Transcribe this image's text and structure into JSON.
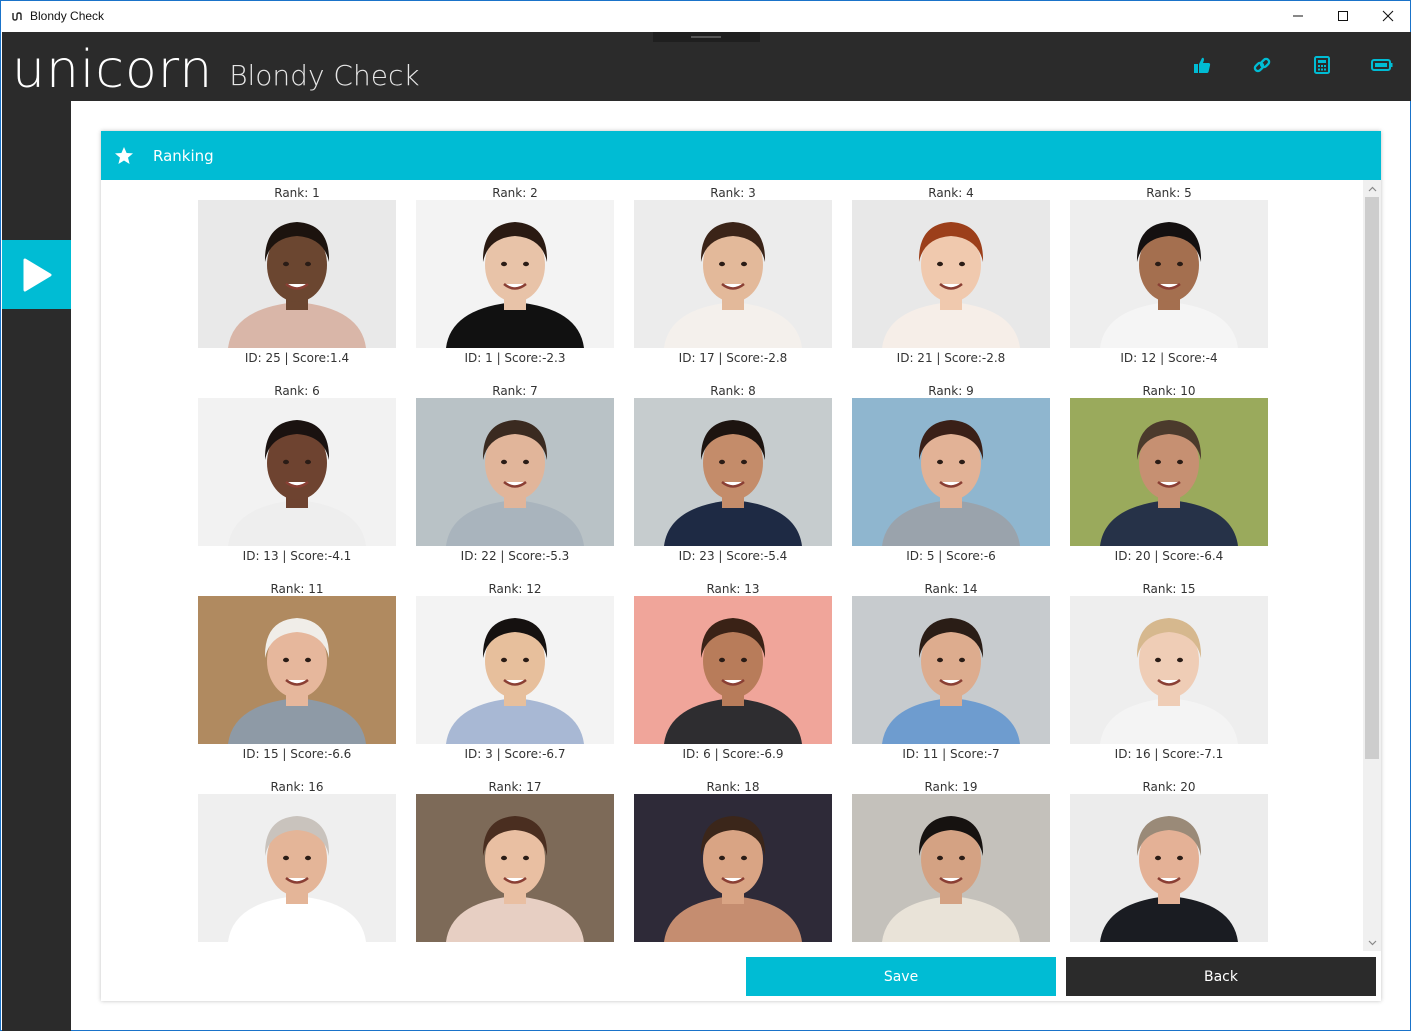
{
  "window": {
    "title": "Blondy Check",
    "controls": [
      "minimize",
      "maximize",
      "close"
    ]
  },
  "header": {
    "brand": "unicorn",
    "app_name": "Blondy Check",
    "icons": [
      "thumbs-up-icon",
      "link-icon",
      "calculator-icon",
      "battery-icon"
    ],
    "accent_color": "#00bcd4"
  },
  "rail": {
    "play_icon": "play-icon"
  },
  "panel": {
    "title": "Ranking",
    "title_icon": "star-icon"
  },
  "ranking": [
    {
      "rank_label": "Rank: 1",
      "caption": "ID: 25 | Score:1.4",
      "bg": "#e9e9e9",
      "skin": "#6b4630",
      "hair": "#1c130e",
      "shirt": "#d9b6a8"
    },
    {
      "rank_label": "Rank: 2",
      "caption": "ID: 1 | Score:-2.3",
      "bg": "#f3f3f3",
      "skin": "#e8c3a8",
      "hair": "#2a1a12",
      "shirt": "#111111"
    },
    {
      "rank_label": "Rank: 3",
      "caption": "ID: 17 | Score:-2.8",
      "bg": "#ececec",
      "skin": "#e3b99a",
      "hair": "#3b2418",
      "shirt": "#f4f0ec"
    },
    {
      "rank_label": "Rank: 4",
      "caption": "ID: 21 | Score:-2.8",
      "bg": "#e8e8e8",
      "skin": "#f0c9ae",
      "hair": "#9c3f1a",
      "shirt": "#f6eee8"
    },
    {
      "rank_label": "Rank: 5",
      "caption": "ID: 12 | Score:-4",
      "bg": "#eeeeee",
      "skin": "#a46f4f",
      "hair": "#141010",
      "shirt": "#f5f5f5"
    },
    {
      "rank_label": "Rank: 6",
      "caption": "ID: 13 | Score:-4.1",
      "bg": "#f2f2f2",
      "skin": "#6e4330",
      "hair": "#1a1210",
      "shirt": "#eeeeee"
    },
    {
      "rank_label": "Rank: 7",
      "caption": "ID: 22 | Score:-5.3",
      "bg": "#b9c2c6",
      "skin": "#e1b59a",
      "hair": "#3a2a20",
      "shirt": "#a9b4bd"
    },
    {
      "rank_label": "Rank: 8",
      "caption": "ID: 23 | Score:-5.4",
      "bg": "#c6ccce",
      "skin": "#c48c6a",
      "hair": "#1d1410",
      "shirt": "#1e2a44"
    },
    {
      "rank_label": "Rank: 9",
      "caption": "ID: 5 | Score:-6",
      "bg": "#8fb6cf",
      "skin": "#e2b296",
      "hair": "#3a2018",
      "shirt": "#9aa3ac"
    },
    {
      "rank_label": "Rank: 10",
      "caption": "ID: 20 | Score:-6.4",
      "bg": "#9aaa5c",
      "skin": "#c69072",
      "hair": "#4b3a2c",
      "shirt": "#263248"
    },
    {
      "rank_label": "Rank: 11",
      "caption": "ID: 15 | Score:-6.6",
      "bg": "#b08a60",
      "skin": "#e6b79c",
      "hair": "#f0ede8",
      "shirt": "#8e9aa6"
    },
    {
      "rank_label": "Rank: 12",
      "caption": "ID: 3 | Score:-6.7",
      "bg": "#f3f3f3",
      "skin": "#e7bf9c",
      "hair": "#151110",
      "shirt": "#a8b8d4"
    },
    {
      "rank_label": "Rank: 13",
      "caption": "ID: 6 | Score:-6.9",
      "bg": "#f0a59a",
      "skin": "#b87c5a",
      "hair": "#3a2216",
      "shirt": "#2e2d30"
    },
    {
      "rank_label": "Rank: 14",
      "caption": "ID: 11 | Score:-7",
      "bg": "#c7cbce",
      "skin": "#ddac8e",
      "hair": "#2a1d16",
      "shirt": "#6e9ccf"
    },
    {
      "rank_label": "Rank: 15",
      "caption": "ID: 16 | Score:-7.1",
      "bg": "#eeeeee",
      "skin": "#efcdb6",
      "hair": "#d6b88e",
      "shirt": "#f4f4f4"
    },
    {
      "rank_label": "Rank: 16",
      "caption": "",
      "bg": "#efefef",
      "skin": "#e4b598",
      "hair": "#c9c3bd",
      "shirt": "#ffffff"
    },
    {
      "rank_label": "Rank: 17",
      "caption": "",
      "bg": "#7d6a58",
      "skin": "#e9bfa2",
      "hair": "#4a2e20",
      "shirt": "#e7cfc3"
    },
    {
      "rank_label": "Rank: 18",
      "caption": "",
      "bg": "#2e2a38",
      "skin": "#d9a484",
      "hair": "#3b261a",
      "shirt": "#c58d70"
    },
    {
      "rank_label": "Rank: 19",
      "caption": "",
      "bg": "#c4c1bb",
      "skin": "#d4a283",
      "hair": "#161210",
      "shirt": "#e9e3d8"
    },
    {
      "rank_label": "Rank: 20",
      "caption": "",
      "bg": "#ececec",
      "skin": "#e4b196",
      "hair": "#9a8a78",
      "shirt": "#1a1c22"
    }
  ],
  "buttons": {
    "save_label": "Save",
    "back_label": "Back"
  }
}
